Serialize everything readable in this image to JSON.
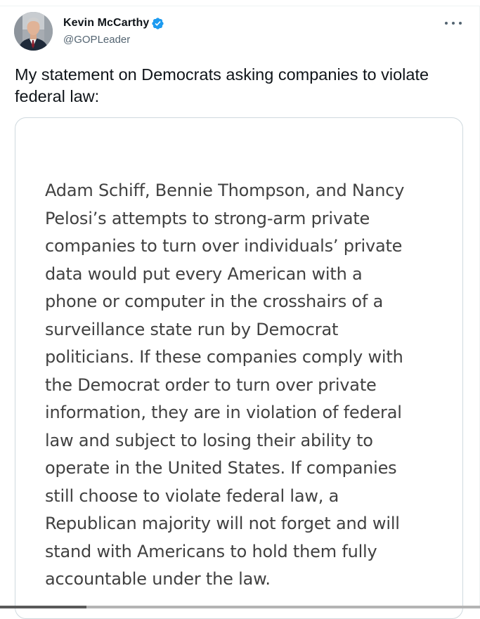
{
  "tweet": {
    "author": {
      "display_name": "Kevin McCarthy",
      "handle": "@GOPLeader",
      "verified": true
    },
    "text": "My statement on Democrats asking companies to violate federal law:",
    "media": {
      "statement_lines": [
        "Adam Schiff, Bennie Thompson, and Nancy",
        "Pelosi’s attempts to strong-arm private",
        "companies to turn over individuals’ private",
        "data would put every American with a",
        "phone or computer in the crosshairs of a",
        "surveillance state run by Democrat",
        "politicians. If these companies comply with",
        "the Democrat order to turn over private",
        "information, they are in violation of federal",
        "law and subject to losing their ability to",
        "operate in the United States. If companies",
        "still choose to violate federal law, a",
        "Republican majority will not forget and will",
        "stand with Americans to hold them fully",
        "accountable under the law."
      ]
    }
  },
  "icons": {
    "verified": "verified-badge-icon",
    "more": "more-options-icon"
  },
  "colors": {
    "verified_blue": "#1d9bf0",
    "primary_text": "#0f1419",
    "secondary_text": "#536471",
    "statement_text": "#414141"
  }
}
